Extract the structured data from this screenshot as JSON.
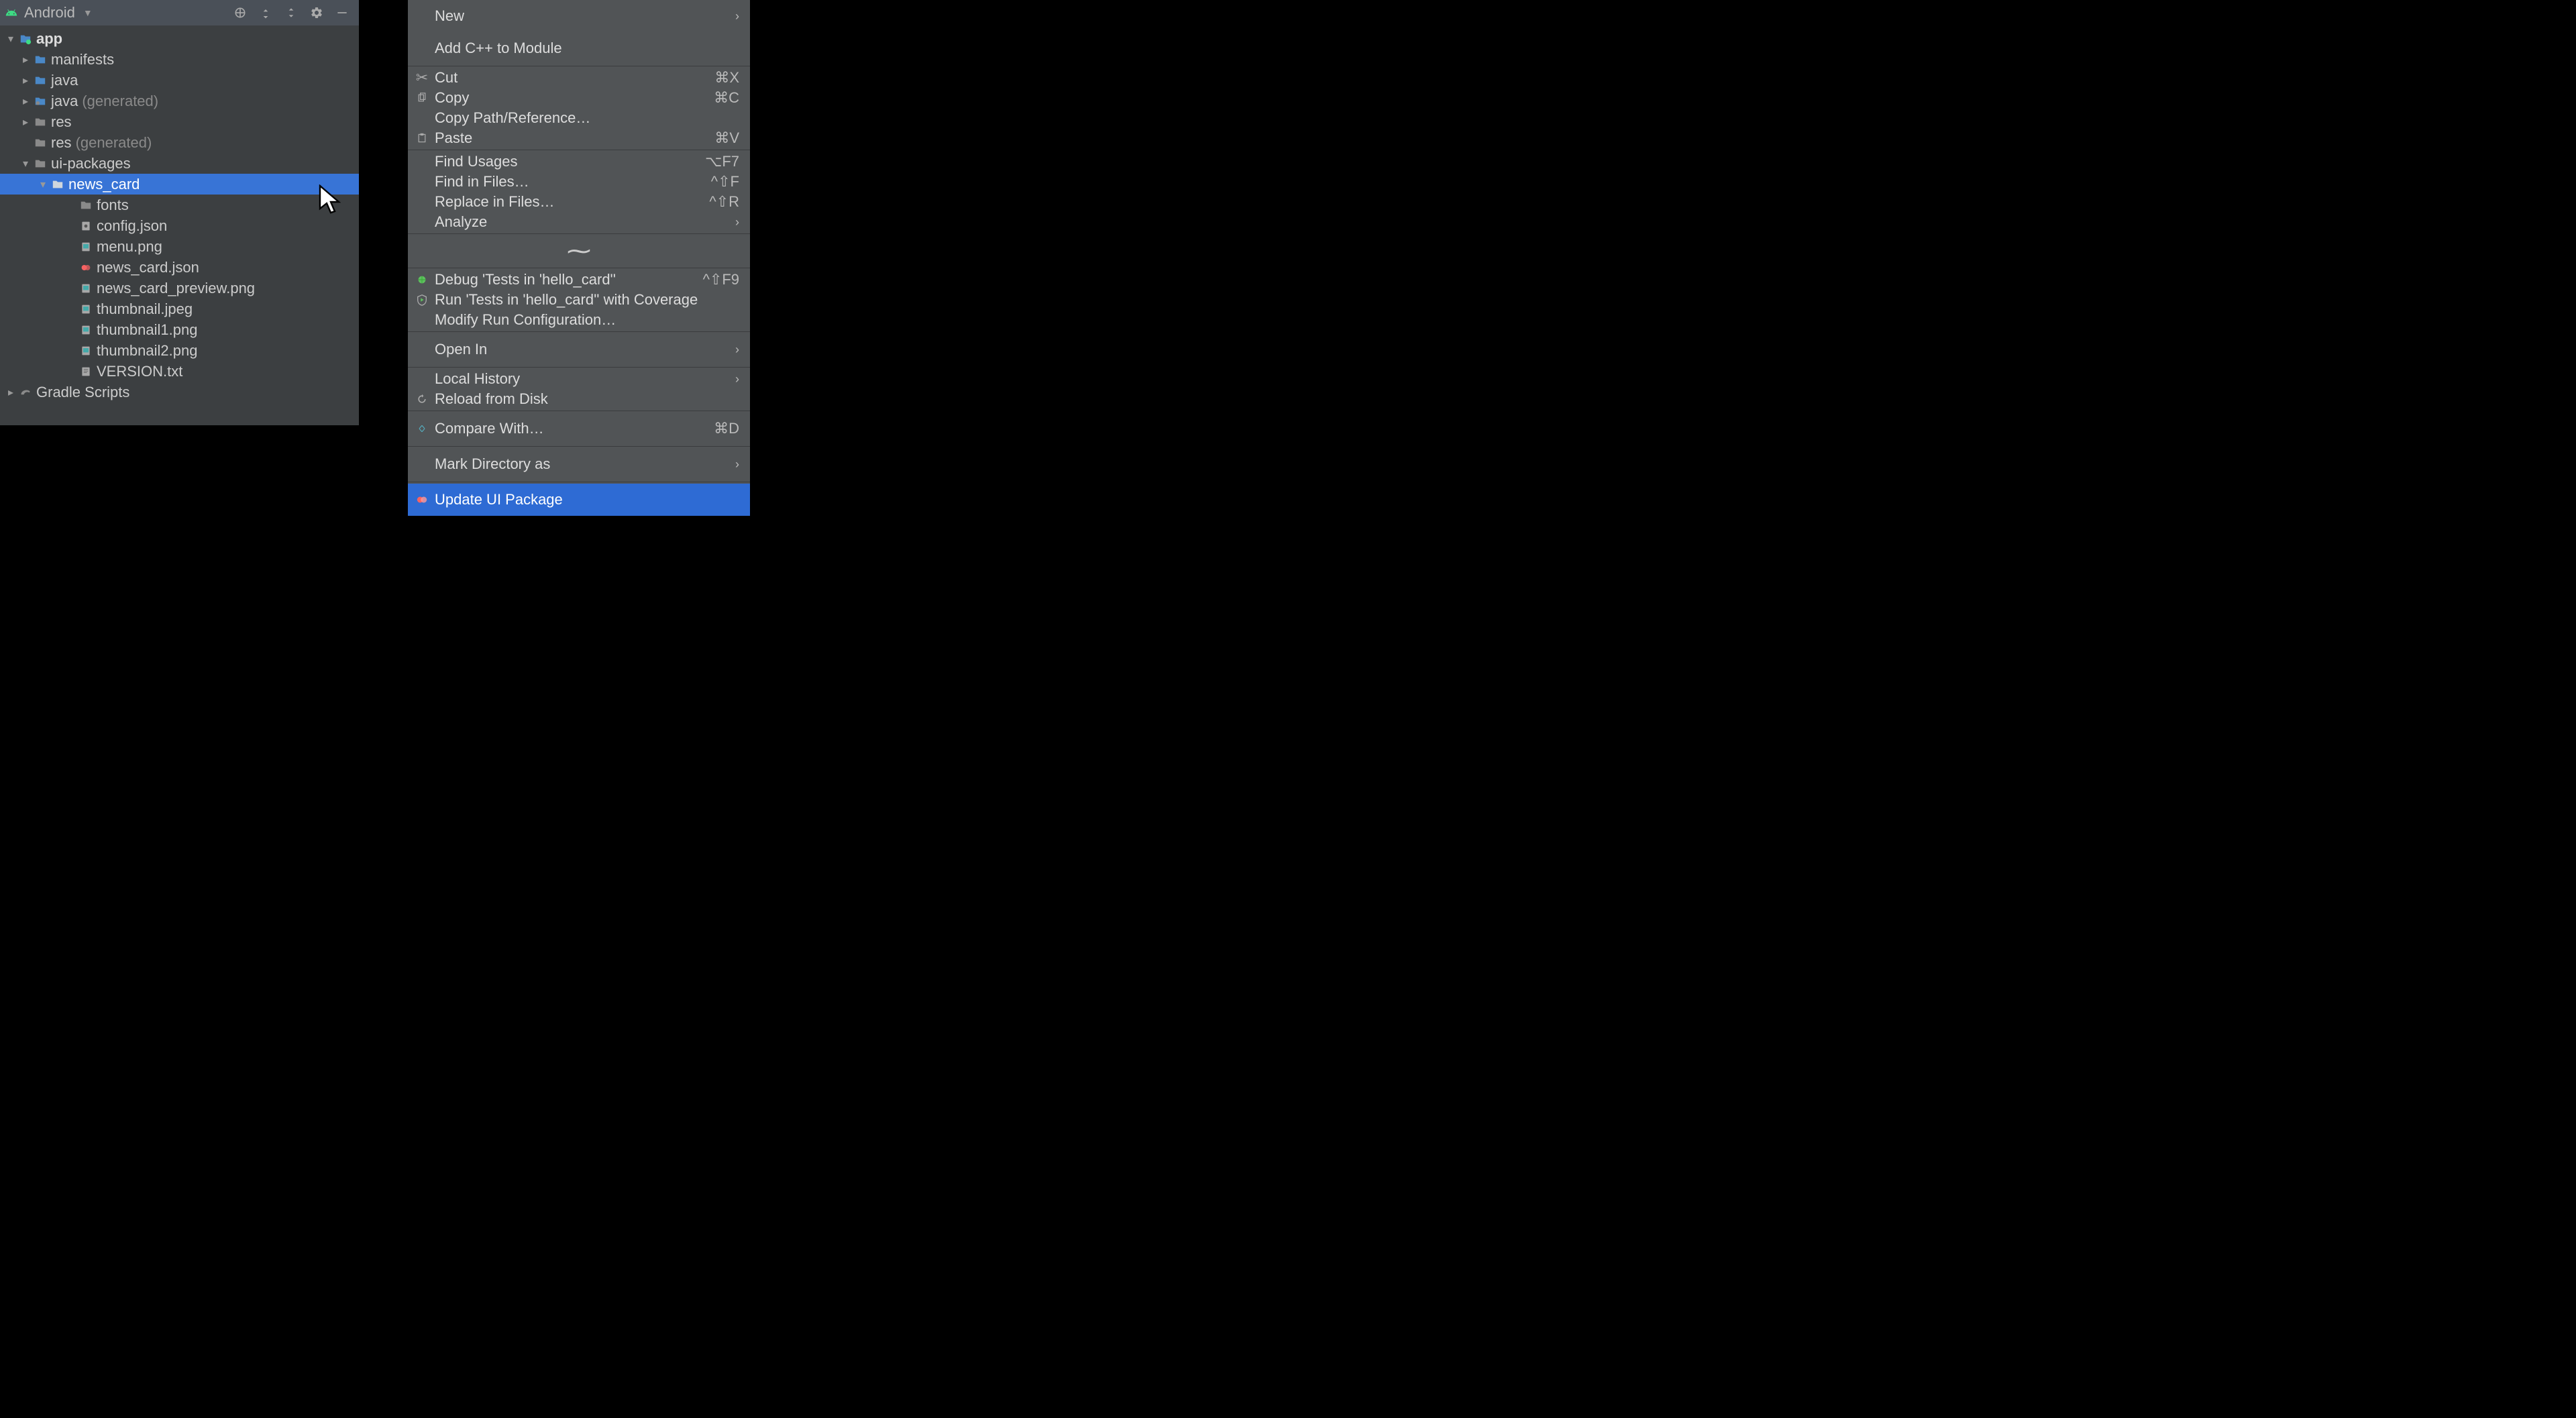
{
  "panel": {
    "title": "Android"
  },
  "tree": {
    "app": "app",
    "manifests": "manifests",
    "java": "java",
    "java_gen": "java",
    "java_gen_suffix": "(generated)",
    "res": "res",
    "res_gen": "res",
    "res_gen_suffix": "(generated)",
    "ui_packages": "ui-packages",
    "news_card": "news_card",
    "fonts": "fonts",
    "config_json": "config.json",
    "menu_png": "menu.png",
    "news_card_json": "news_card.json",
    "news_card_preview_png": "news_card_preview.png",
    "thumbnail_jpeg": "thumbnail.jpeg",
    "thumbnail1_png": "thumbnail1.png",
    "thumbnail2_png": "thumbnail2.png",
    "version_txt": "VERSION.txt",
    "gradle_scripts": "Gradle Scripts"
  },
  "menu": {
    "new": "New",
    "add_cpp": "Add C++ to Module",
    "cut": "Cut",
    "cut_sc": "⌘X",
    "copy": "Copy",
    "copy_sc": "⌘C",
    "copy_path": "Copy Path/Reference…",
    "paste": "Paste",
    "paste_sc": "⌘V",
    "find_usages": "Find Usages",
    "find_usages_sc": "⌥F7",
    "find_in_files": "Find in Files…",
    "find_in_files_sc": "^⇧F",
    "replace_in_files": "Replace in Files…",
    "replace_in_files_sc": "^⇧R",
    "analyze": "Analyze",
    "debug_tests": "Debug 'Tests in 'hello_card''",
    "debug_tests_sc": "^⇧F9",
    "run_coverage": "Run 'Tests in 'hello_card'' with Coverage",
    "modify_run": "Modify Run Configuration…",
    "open_in": "Open In",
    "local_history": "Local History",
    "reload_disk": "Reload from Disk",
    "compare_with": "Compare With…",
    "compare_with_sc": "⌘D",
    "mark_directory": "Mark Directory as",
    "update_ui_package": "Update UI Package"
  }
}
